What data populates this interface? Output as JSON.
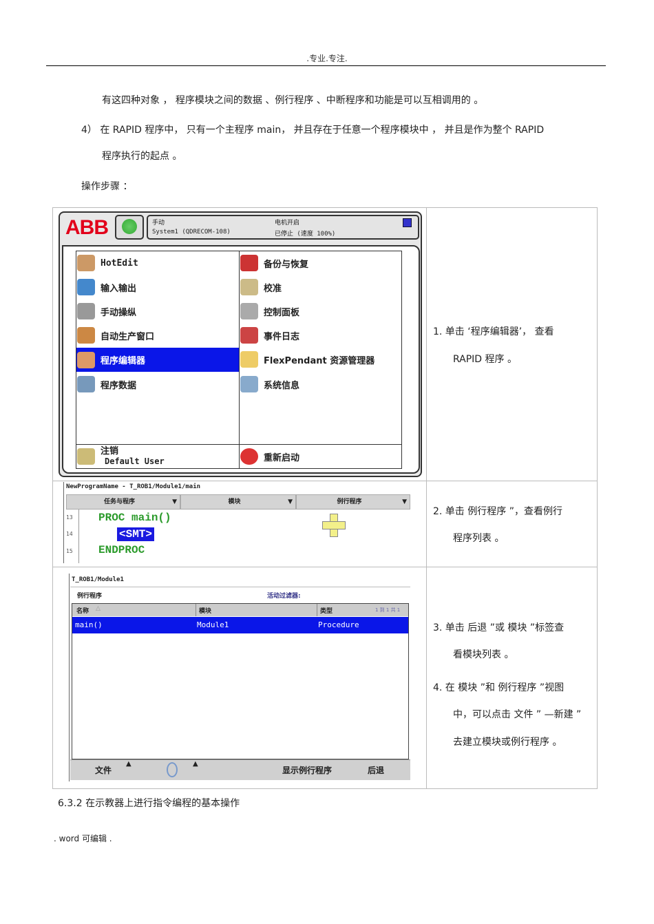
{
  "header": ".专业.专注.",
  "paragraphs": [
    "有这四种对象 ， 程序模块之间的数据 、例行程序 、中断程序和功能是可以互相调用的 。",
    "4） 在 RAPID 程序中， 只有一个主程序 main， 并且存在于任意一个程序模块中 ， 并且是作为整个 RAPID",
    "程序执行的起点 。",
    "操作步骤 ："
  ],
  "screen1": {
    "logo": "ABB",
    "status": {
      "mode": "手动",
      "system": "System1 (QDRECOM-108)",
      "motor": "电机开启",
      "state": "已停止 (速度 100%)"
    },
    "left_items": [
      "HotEdit",
      "输入输出",
      "手动操纵",
      "自动生产窗口",
      "程序编辑器",
      "程序数据"
    ],
    "right_items": [
      "备份与恢复",
      "校准",
      "控制面板",
      "事件日志",
      "FlexPendant 资源管理器",
      "系统信息"
    ],
    "logout": "注销",
    "user": "Default User",
    "restart": "重新启动"
  },
  "screen2": {
    "title": "NewProgramName - T_ROB1/Module1/main",
    "tabs": [
      "任务与程序",
      "模块",
      "例行程序"
    ],
    "lines": [
      {
        "n": "13",
        "code": "PROC main()"
      },
      {
        "n": "14",
        "code": "<SMT>"
      },
      {
        "n": "15",
        "code": "ENDPROC"
      }
    ]
  },
  "screen3": {
    "title": "T_ROB1/Module1",
    "section": "例行程序",
    "filter": "活动过滤器:",
    "columns": [
      "名称",
      "模块",
      "类型"
    ],
    "paging": "1 到 1 共 1",
    "row": [
      "main()",
      "Module1",
      "Procedure"
    ],
    "bottom": {
      "file": "文件",
      "show": "显示例行程序",
      "back": "后退"
    }
  },
  "steps": {
    "s1": [
      "1.  单击 ‘程序编辑器’， 查看",
      "RAPID 程序 。"
    ],
    "s2": [
      "2.  单击 例行程序 ”，查看例行",
      "程序列表 。"
    ],
    "s3": [
      "3.  单击 后退 ”或 模块 ”标签查",
      "看模块列表 。"
    ],
    "s4": [
      "4.  在 模块 ”和 例行程序 ”视图",
      "中，可以点击 文件 ” —新建 ”",
      "去建立模块或例行程序 。"
    ]
  },
  "caption": "6.3.2  在示教器上进行指令编程的基本操作",
  "footer": ". word 可编辑 ."
}
